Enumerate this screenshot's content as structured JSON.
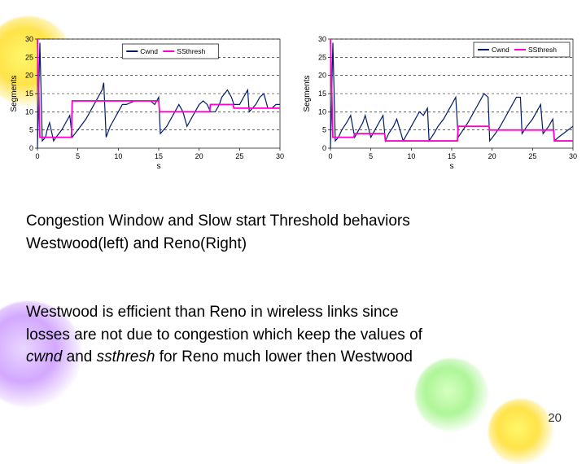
{
  "page_number": "20",
  "caption1_line1": "Congestion Window and Slow start Threshold behaviors",
  "caption1_line2": "Westwood(left) and Reno(Right)",
  "caption2_line1": "Westwood is efficient than Reno in wireless links  since",
  "caption2_line2": "losses are not due to congestion which keep the values of",
  "caption2_line3_a": "cwnd",
  "caption2_line3_b": " and ",
  "caption2_line3_c": "ssthresh",
  "caption2_line3_d": " for Reno much lower then Westwood",
  "chart_data": [
    {
      "type": "line",
      "title": "Westwood",
      "xlabel": "s",
      "ylabel": "Segments",
      "xlim": [
        0,
        30
      ],
      "ylim": [
        0,
        30
      ],
      "xticks": [
        0,
        5,
        10,
        15,
        20,
        25,
        30
      ],
      "yticks": [
        0,
        5,
        10,
        15,
        20,
        25,
        30
      ],
      "legend": [
        "Cwnd",
        "SSthresh"
      ],
      "series": [
        {
          "name": "Cwnd",
          "color": "#001a66",
          "x": [
            0,
            0.3,
            0.6,
            1,
            1.2,
            1.5,
            2,
            2.3,
            3,
            3.5,
            4,
            4.3,
            5,
            6,
            6.5,
            7,
            7.5,
            8,
            8.2,
            8.5,
            9,
            9.5,
            10,
            10.5,
            11,
            12,
            12.5,
            13,
            13.5,
            14,
            14.5,
            15,
            15.2,
            16,
            16.5,
            17,
            17.5,
            18,
            18.5,
            19,
            19.5,
            20,
            20.5,
            21,
            21.4,
            22,
            22.5,
            22.8,
            23.5,
            24,
            24.3,
            25,
            25.5,
            26,
            26.2,
            27,
            27.5,
            28,
            28.5,
            29,
            29.5,
            30
          ],
          "y": [
            0,
            29,
            2,
            3,
            5,
            7,
            2,
            3,
            5,
            7,
            9,
            3,
            5,
            8,
            10,
            12,
            14,
            16,
            18,
            3,
            6,
            8,
            10,
            12,
            12,
            13,
            13,
            13,
            13,
            13,
            12,
            14,
            4,
            6,
            8,
            10,
            12,
            10,
            6,
            8,
            10,
            12,
            13,
            12,
            10,
            10,
            12,
            14,
            16,
            14,
            12,
            12,
            14,
            16,
            10,
            12,
            14,
            15,
            11,
            11,
            12,
            12
          ]
        },
        {
          "name": "SSthresh",
          "color": "#ff00cc",
          "x": [
            0,
            0.3,
            1.2,
            1.3,
            2.2,
            2.3,
            4.2,
            4.3,
            8.4,
            8.5,
            15,
            15.1,
            17.9,
            18,
            21.3,
            21.4,
            22.7,
            22.8,
            24.2,
            24.3,
            26.1,
            26.2,
            30
          ],
          "y": [
            30,
            3,
            3,
            3,
            3,
            3,
            3,
            13,
            13,
            13,
            13,
            10,
            10,
            10,
            10,
            12,
            12,
            12,
            12,
            11,
            11,
            11,
            11
          ]
        }
      ]
    },
    {
      "type": "line",
      "title": "Reno",
      "xlabel": "s",
      "ylabel": "Segments",
      "xlim": [
        0,
        30
      ],
      "ylim": [
        0,
        30
      ],
      "xticks": [
        0,
        5,
        10,
        15,
        20,
        25,
        30
      ],
      "yticks": [
        0,
        5,
        10,
        15,
        20,
        25,
        30
      ],
      "legend": [
        "Cwnd",
        "SSthresh"
      ],
      "series": [
        {
          "name": "Cwnd",
          "color": "#001a66",
          "x": [
            0,
            0.3,
            0.6,
            1,
            1.4,
            2,
            2.5,
            3,
            3.5,
            4,
            4.3,
            5,
            5.5,
            6,
            6.5,
            6.8,
            7.2,
            7.8,
            8.2,
            9,
            9.5,
            10,
            10.5,
            11,
            11.5,
            12,
            12.2,
            12.8,
            13.3,
            14,
            14.5,
            15,
            15.5,
            15.8,
            16.4,
            17,
            17.5,
            18,
            18.5,
            19,
            19.5,
            19.7,
            20.4,
            21,
            21.5,
            22,
            22.5,
            23,
            23.5,
            23.7,
            24.3,
            25,
            25.5,
            26,
            26.3,
            27,
            27.5,
            27.7,
            28.2,
            28.8,
            29.4,
            30
          ],
          "y": [
            0,
            29,
            2,
            3,
            5,
            7,
            9,
            3,
            5,
            7,
            9,
            3,
            5,
            7,
            9,
            2,
            4,
            6,
            8,
            2,
            4,
            6,
            8,
            10,
            9,
            11,
            2,
            4,
            6,
            8,
            10,
            12,
            14,
            3,
            5,
            7,
            9,
            11,
            13,
            15,
            14,
            2,
            4,
            6,
            8,
            10,
            12,
            14,
            14,
            4,
            6,
            8,
            10,
            12,
            4,
            6,
            8,
            2,
            3,
            4,
            5,
            6
          ]
        },
        {
          "name": "SSthresh",
          "color": "#ff00cc",
          "x": [
            0,
            0.3,
            2.9,
            3,
            4.2,
            4.3,
            6.7,
            6.8,
            8.9,
            9,
            12.1,
            12.2,
            15.7,
            15.8,
            19.6,
            19.7,
            23.6,
            23.7,
            26.2,
            26.3,
            27.6,
            27.7,
            30
          ],
          "y": [
            30,
            3,
            3,
            4,
            4,
            4,
            4,
            2,
            2,
            2,
            2,
            2,
            2,
            6,
            6,
            5,
            5,
            5,
            5,
            5,
            5,
            2,
            2
          ]
        }
      ]
    }
  ]
}
